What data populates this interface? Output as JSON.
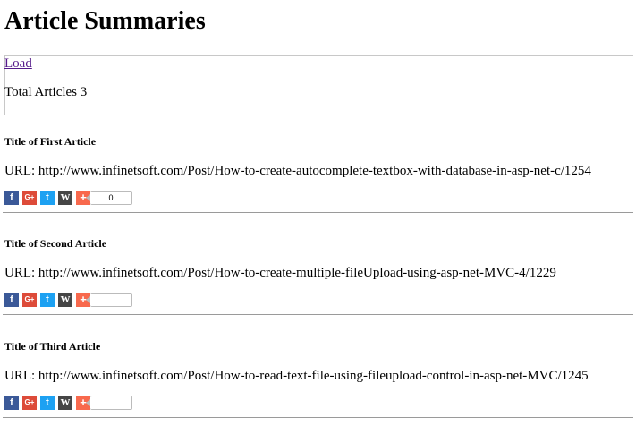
{
  "header": {
    "title": "Article Summaries"
  },
  "load_panel": {
    "load_label": "Load",
    "total_label": "Total Articles 3"
  },
  "icons": {
    "facebook": "f",
    "google_plus": "G+",
    "twitter": "t",
    "wordpress": "W",
    "share_plus": "+"
  },
  "colors": {
    "facebook": "#3b5998",
    "google_plus": "#dd4b39",
    "twitter": "#1da1f2",
    "wordpress": "#464646",
    "share_plus": "#f8694d",
    "link": "#551a8b"
  },
  "articles": [
    {
      "title": "Title of First Article",
      "url_text": "URL: http://www.infinetsoft.com/Post/How-to-create-autocomplete-textbox-with-database-in-asp-net-c/1254",
      "share_count": "0"
    },
    {
      "title": "Title of Second Article",
      "url_text": "URL: http://www.infinetsoft.com/Post/How-to-create-multiple-fileUpload-using-asp-net-MVC-4/1229",
      "share_count": ""
    },
    {
      "title": "Title of Third Article",
      "url_text": "URL: http://www.infinetsoft.com/Post/How-to-read-text-file-using-fileupload-control-in-asp-net-MVC/1245",
      "share_count": ""
    }
  ]
}
